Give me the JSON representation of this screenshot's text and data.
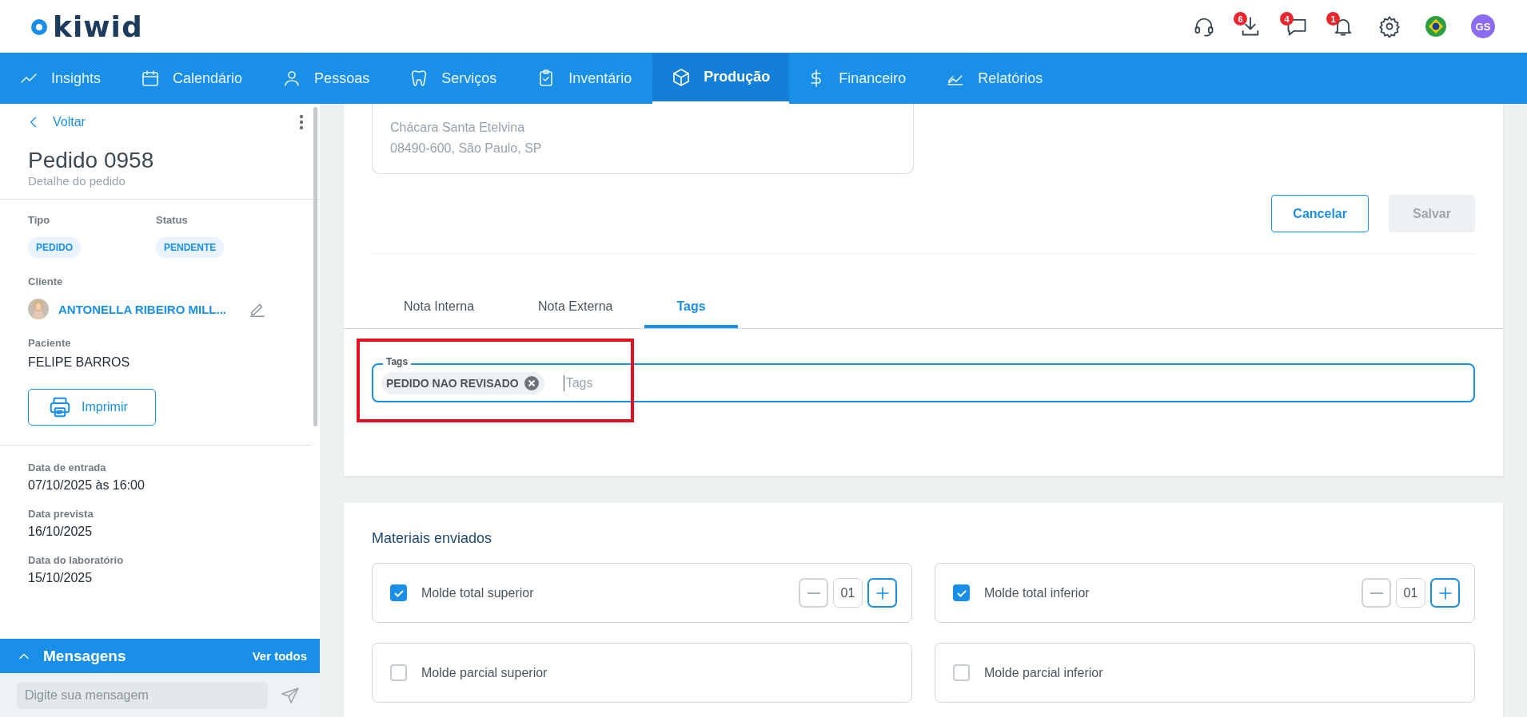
{
  "header": {
    "logo": "kiwid",
    "actions": [
      {
        "kind": "headset"
      },
      {
        "kind": "download",
        "badge": "6"
      },
      {
        "kind": "chat",
        "badge": "4"
      },
      {
        "kind": "bell",
        "badge": "1"
      },
      {
        "kind": "gear"
      },
      {
        "kind": "flag"
      },
      {
        "kind": "avatar",
        "initials": "GS"
      }
    ]
  },
  "nav": [
    {
      "label": "Insights",
      "kind": "trend",
      "selected": false
    },
    {
      "label": "Calendário",
      "kind": "calendar",
      "selected": false
    },
    {
      "label": "Pessoas",
      "kind": "person",
      "selected": false
    },
    {
      "label": "Serviços",
      "kind": "tooth",
      "selected": false
    },
    {
      "label": "Inventário",
      "kind": "clipboard",
      "selected": false
    },
    {
      "label": "Produção",
      "kind": "box",
      "selected": true
    },
    {
      "label": "Financeiro",
      "kind": "dollar",
      "selected": false
    },
    {
      "label": "Relatórios",
      "kind": "chart",
      "selected": false
    }
  ],
  "sidebar": {
    "back": "Voltar",
    "title": "Pedido 0958",
    "subtitle": "Detalhe do pedido",
    "type_label": "Tipo",
    "type_chip": "PEDIDO",
    "status_label": "Status",
    "status_chip": "PENDENTE",
    "client_label": "Cliente",
    "client_name": "ANTONELLA RIBEIRO MILL...",
    "patient_label": "Paciente",
    "patient_name": "FELIPE BARROS",
    "print_button": "Imprimir",
    "dates": [
      {
        "label": "Data de entrada",
        "value": "07/10/2025 às 16:00"
      },
      {
        "label": "Data prevista",
        "value": "16/10/2025"
      },
      {
        "label": "Data do laboratório",
        "value": "15/10/2025"
      }
    ],
    "messages": {
      "title": "Mensagens",
      "link": "Ver todos",
      "placeholder": "Digite sua mensagem"
    }
  },
  "main": {
    "address_lines": [
      "Chácara Santa Etelvina",
      "08490-600, São Paulo, SP"
    ],
    "buttons": [
      {
        "label": "Cancelar",
        "disabled": false
      },
      {
        "label": "Salvar",
        "disabled": true
      }
    ],
    "tabs": [
      {
        "label": "Nota Interna",
        "selected": false
      },
      {
        "label": "Nota Externa",
        "selected": false
      },
      {
        "label": "Tags",
        "selected": true
      }
    ],
    "tags_field": {
      "label": "Tags",
      "chips": [
        "PEDIDO NAO REVISADO"
      ],
      "placeholder": "Tags"
    },
    "materials": {
      "title": "Materiais enviados",
      "items": [
        {
          "label": "Molde total superior",
          "checked": true,
          "quantity": "01"
        },
        {
          "label": "Molde total inferior",
          "checked": true,
          "quantity": "01"
        },
        {
          "label": "Molde parcial superior",
          "checked": false
        },
        {
          "label": "Molde parcial inferior",
          "checked": false
        }
      ]
    }
  }
}
